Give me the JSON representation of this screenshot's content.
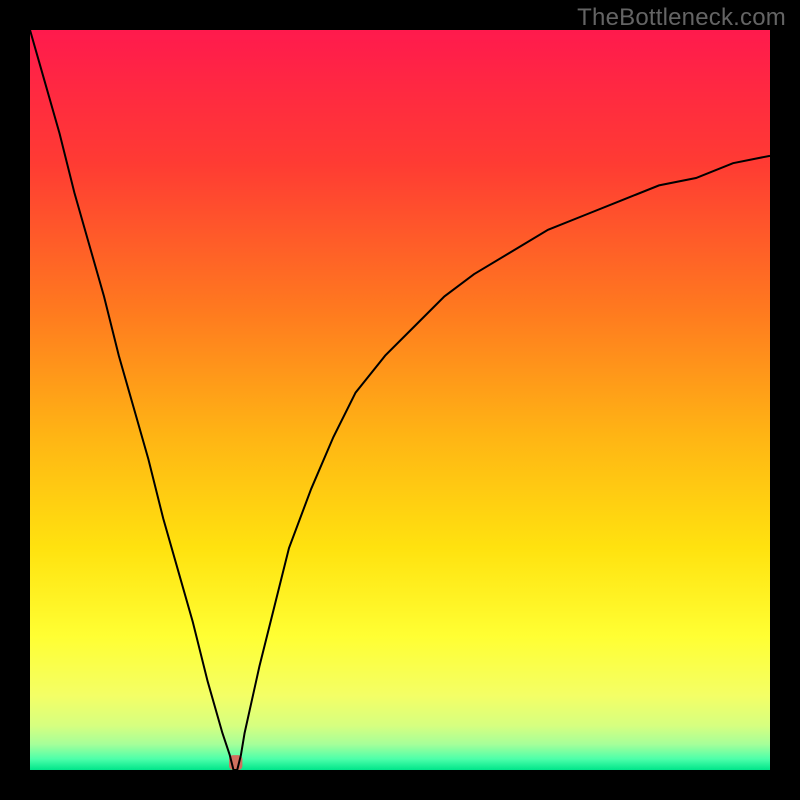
{
  "watermark": "TheBottleneck.com",
  "chart_data": {
    "type": "line",
    "title": "",
    "xlabel": "",
    "ylabel": "",
    "xlim": [
      0,
      1
    ],
    "ylim": [
      0,
      100
    ],
    "x": [
      0.0,
      0.02,
      0.04,
      0.06,
      0.08,
      0.1,
      0.12,
      0.14,
      0.16,
      0.18,
      0.2,
      0.22,
      0.24,
      0.26,
      0.27,
      0.275,
      0.28,
      0.285,
      0.29,
      0.31,
      0.33,
      0.35,
      0.38,
      0.41,
      0.44,
      0.48,
      0.52,
      0.56,
      0.6,
      0.65,
      0.7,
      0.75,
      0.8,
      0.85,
      0.9,
      0.95,
      1.0
    ],
    "y": [
      100,
      93,
      86,
      78,
      71,
      64,
      56,
      49,
      42,
      34,
      27,
      20,
      12,
      5,
      2,
      0,
      0,
      2,
      5,
      14,
      22,
      30,
      38,
      45,
      51,
      56,
      60,
      64,
      67,
      70,
      73,
      75,
      77,
      79,
      80,
      82,
      83
    ],
    "curve_color": "#000000",
    "marker": {
      "x": 0.278,
      "y": 0,
      "color": "#d0705e",
      "width": 0.018,
      "height_pct": 1.2
    },
    "background": {
      "type": "vertical-gradient",
      "stops": [
        {
          "offset": 0.0,
          "color": "#ff1a4d"
        },
        {
          "offset": 0.18,
          "color": "#ff3b33"
        },
        {
          "offset": 0.38,
          "color": "#ff7a1f"
        },
        {
          "offset": 0.55,
          "color": "#ffb514"
        },
        {
          "offset": 0.7,
          "color": "#ffe20f"
        },
        {
          "offset": 0.82,
          "color": "#ffff33"
        },
        {
          "offset": 0.9,
          "color": "#f4ff66"
        },
        {
          "offset": 0.94,
          "color": "#d6ff80"
        },
        {
          "offset": 0.965,
          "color": "#a6ff99"
        },
        {
          "offset": 0.985,
          "color": "#4dffaa"
        },
        {
          "offset": 1.0,
          "color": "#00e58a"
        }
      ]
    }
  }
}
